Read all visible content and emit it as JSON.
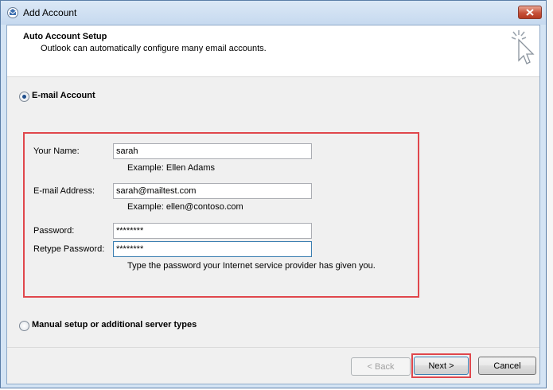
{
  "window": {
    "title": "Add Account"
  },
  "header": {
    "title": "Auto Account Setup",
    "subtitle": "Outlook can automatically configure many email accounts."
  },
  "options": {
    "email_account_label": "E-mail Account",
    "email_account_selected": true,
    "manual_setup_label": "Manual setup or additional server types",
    "manual_setup_selected": false
  },
  "form": {
    "your_name_label": "Your Name:",
    "your_name_value": "sarah",
    "your_name_example": "Example: Ellen Adams",
    "email_label": "E-mail Address:",
    "email_value": "sarah@mailtest.com",
    "email_example": "Example: ellen@contoso.com",
    "password_label": "Password:",
    "password_value": "********",
    "retype_password_label": "Retype Password:",
    "retype_password_value": "********",
    "password_hint": "Type the password your Internet service provider has given you."
  },
  "footer": {
    "back_label": "< Back",
    "next_label": "Next >",
    "cancel_label": "Cancel"
  },
  "colors": {
    "highlight": "#e0474c",
    "titlebar": "#c6d9ef",
    "close": "#c7513a"
  }
}
